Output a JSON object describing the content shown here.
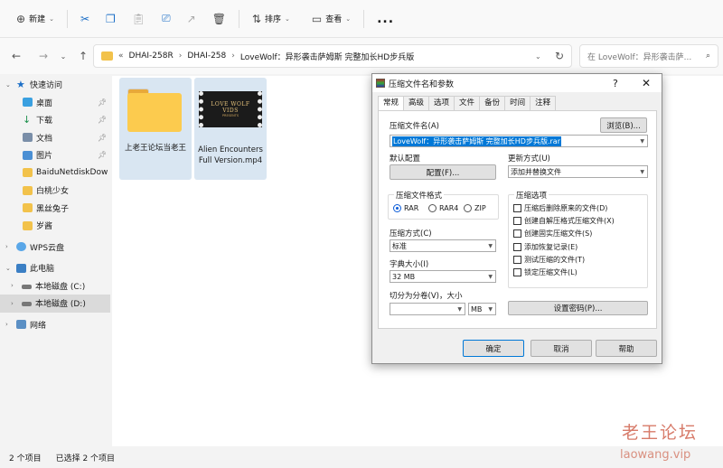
{
  "toolbar": {
    "new_label": "新建",
    "sort_label": "排序",
    "view_label": "查看",
    "more_label": "..."
  },
  "address": {
    "overflow": "«",
    "crumbs": [
      "DHAI-258R",
      "DHAI-258",
      "LoveWolf：异形袭击萨姆斯 完整加长HD步兵版"
    ],
    "search_placeholder": "在 LoveWolf：异形袭击萨..."
  },
  "sidebar": {
    "items": [
      {
        "label": "快速访问"
      },
      {
        "label": "桌面"
      },
      {
        "label": "下载"
      },
      {
        "label": "文档"
      },
      {
        "label": "图片"
      },
      {
        "label": "BaiduNetdiskDow"
      },
      {
        "label": "白桃少女"
      },
      {
        "label": "黑丝兔子"
      },
      {
        "label": "岁酱"
      },
      {
        "label": "WPS云盘"
      },
      {
        "label": "此电脑"
      },
      {
        "label": "本地磁盘 (C:)"
      },
      {
        "label": "本地磁盘 (D:)"
      },
      {
        "label": "网络"
      }
    ]
  },
  "files": [
    {
      "label": "上老王论坛当老王"
    },
    {
      "label": "Alien Encounters Full Version.mp4",
      "thumb_title": "LOVE WOLF VIDS",
      "thumb_sub": "PRESENTS"
    }
  ],
  "status": {
    "count": "2 个项目",
    "selected": "已选择 2 个项目"
  },
  "watermark": {
    "cn": "老王论坛",
    "url": "laowang.vip"
  },
  "dialog": {
    "title": "压缩文件名和参数",
    "help": "?",
    "tabs": [
      "常规",
      "高级",
      "选项",
      "文件",
      "备份",
      "时间",
      "注释"
    ],
    "archive_name_label": "压缩文件名(A)",
    "browse_label": "浏览(B)...",
    "archive_name_value": "LoveWolf：异形袭击萨姆斯 完整加长HD步兵版.rar",
    "default_profile_label": "默认配置",
    "profiles_button": "配置(F)...",
    "update_mode_label": "更新方式(U)",
    "update_mode_value": "添加并替换文件",
    "format_group": "压缩文件格式",
    "formats": [
      "RAR",
      "RAR4",
      "ZIP"
    ],
    "options_group": "压缩选项",
    "options": [
      "压缩后删除原来的文件(D)",
      "创建自解压格式压缩文件(X)",
      "创建固实压缩文件(S)",
      "添加恢复记录(E)",
      "测试压缩的文件(T)",
      "锁定压缩文件(L)"
    ],
    "method_label": "压缩方式(C)",
    "method_value": "标准",
    "dict_label": "字典大小(I)",
    "dict_value": "32 MB",
    "split_label": "切分为分卷(V)，大小",
    "split_value": "",
    "split_unit": "MB",
    "password_button": "设置密码(P)...",
    "ok": "确定",
    "cancel": "取消",
    "help_button": "帮助"
  },
  "colors": {
    "selection": "#d9e6f2",
    "accent": "#0078d7",
    "folder": "#fccb4e"
  }
}
